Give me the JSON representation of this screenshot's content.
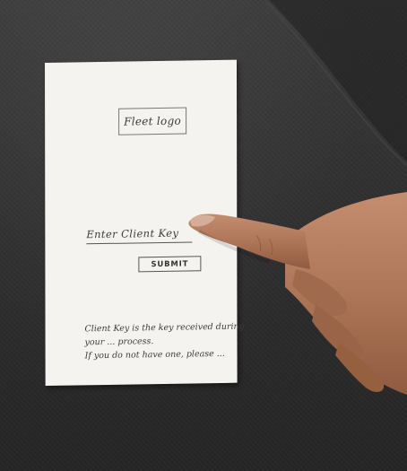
{
  "paper": {
    "logo_label": "Fleet logo",
    "input_label": "Enter Client Key",
    "submit_label": "SUBMIT",
    "help_lines": [
      "Client Key is the key received during",
      "your ... process.",
      "If you do not have one, please ..."
    ]
  },
  "colors": {
    "background": "#2e2e2e",
    "paper": "#f4f3ef",
    "skin": "#b07a5e"
  }
}
